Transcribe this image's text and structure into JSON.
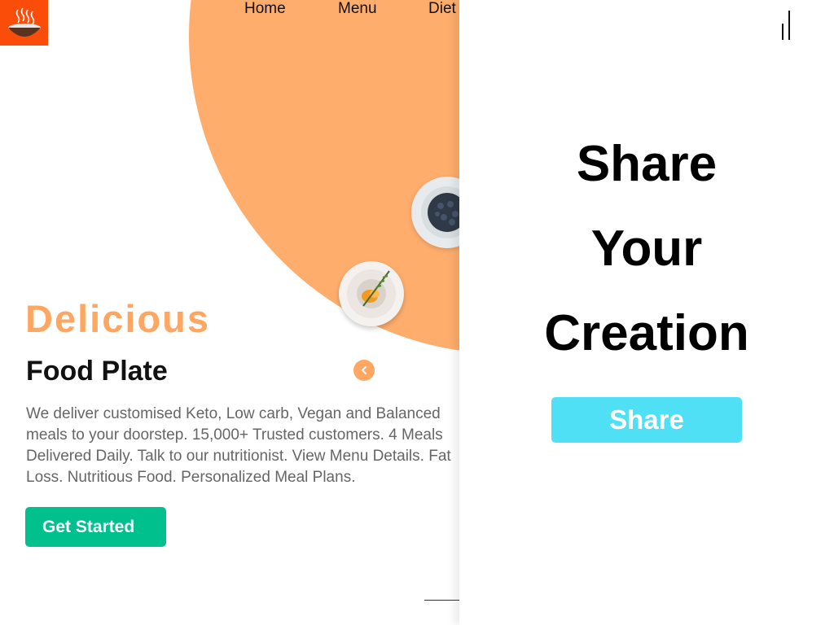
{
  "nav": {
    "items": [
      "Home",
      "Menu",
      "Diet"
    ]
  },
  "hero": {
    "title": "Delicious",
    "subtitle": "Food Plate",
    "description": "We deliver customised Keto, Low carb, Vegan and Balanced meals to your doorstep. 15,000+ Trusted customers. 4 Meals Delivered Daily. Talk to our nutritionist. View Menu Details. Fat Loss. Nutritious Food. Personalized Meal Plans.",
    "cta_label": "Get Started"
  },
  "share_panel": {
    "title_lines": [
      "Share",
      "Your",
      "Creation"
    ],
    "button_label": "Share"
  },
  "colors": {
    "accent_orange": "#fead6c",
    "logo_bg": "#fa4d09",
    "cta_green": "#00c18e",
    "share_cyan": "#4fe0f5"
  },
  "icons": {
    "logo": "steaming-bowl-icon",
    "prev": "chevron-left-icon",
    "close": "close-icon"
  }
}
